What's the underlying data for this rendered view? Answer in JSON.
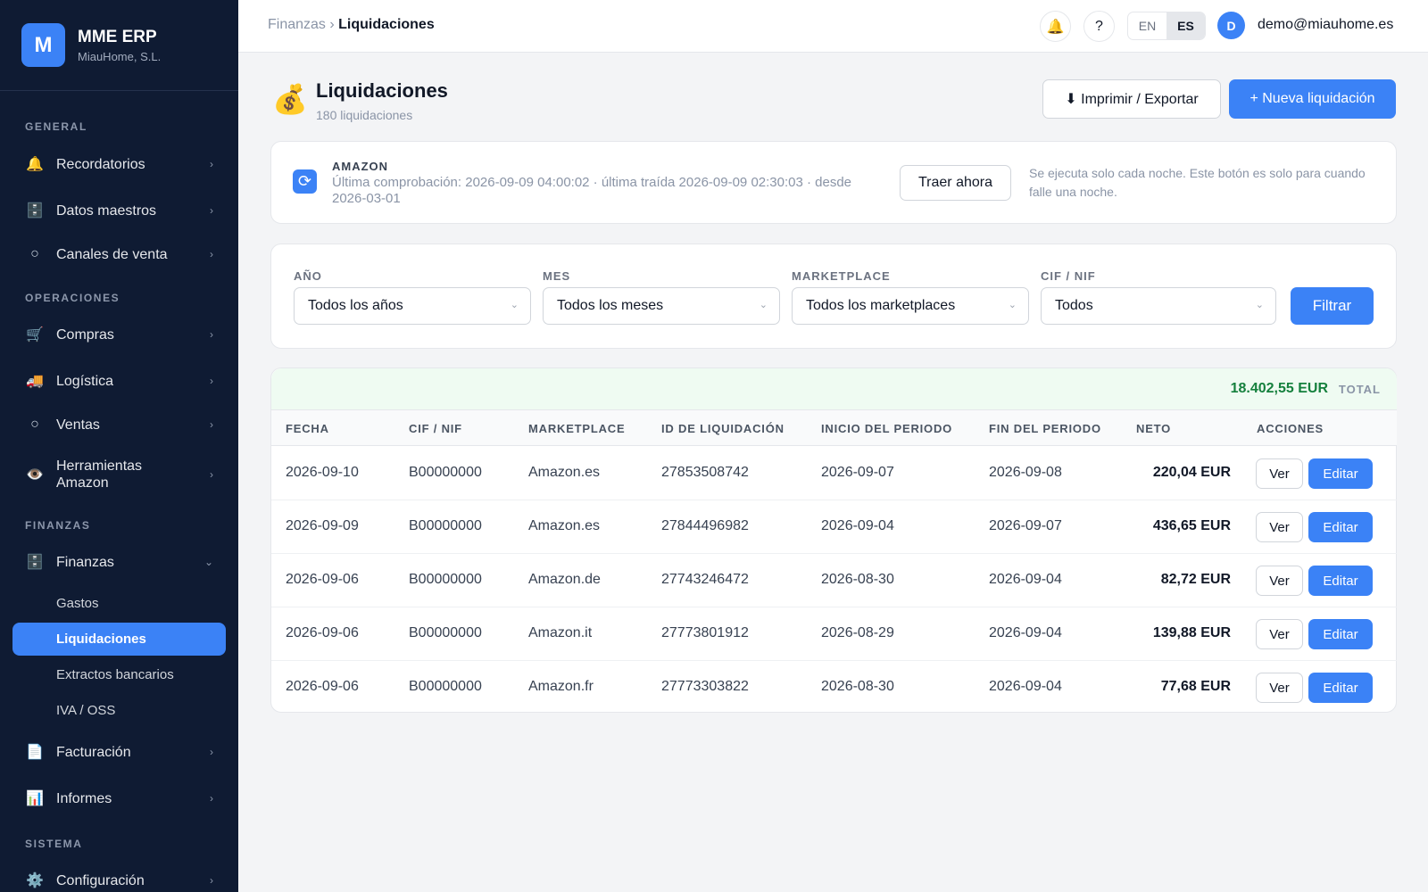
{
  "app": {
    "logo_letter": "M",
    "name": "MME ERP",
    "company": "MiauHome, S.L."
  },
  "sidebar": {
    "sections": {
      "general": "GENERAL",
      "operaciones": "OPERACIONES",
      "finanzas": "FINANZAS",
      "sistema": "SISTEMA"
    },
    "items": {
      "recordatorios": {
        "label": "Recordatorios",
        "icon": "bell-icon"
      },
      "datos_maestros": {
        "label": "Datos maestros",
        "icon": "cabinet-icon"
      },
      "canales_venta": {
        "label": "Canales de venta",
        "icon": "circle-icon"
      },
      "compras": {
        "label": "Compras",
        "icon": "cart-icon"
      },
      "logistica": {
        "label": "Logística",
        "icon": "truck-icon"
      },
      "ventas": {
        "label": "Ventas",
        "icon": "circle-icon"
      },
      "herramientas_amazon": {
        "label": "Herramientas Amazon",
        "icon": "eye-icon"
      },
      "finanzas": {
        "label": "Finanzas",
        "icon": "cabinet-icon"
      },
      "facturacion": {
        "label": "Facturación",
        "icon": "document-icon"
      },
      "informes": {
        "label": "Informes",
        "icon": "bar-chart-icon"
      },
      "configuracion": {
        "label": "Configuración",
        "icon": "gear-icon"
      }
    },
    "finanzas_sub": {
      "gastos": "Gastos",
      "liquidaciones": "Liquidaciones",
      "extractos": "Extractos bancarios",
      "iva": "IVA / OSS"
    }
  },
  "topbar": {
    "breadcrumb_parent": "Finanzas",
    "breadcrumb_sep": "›",
    "breadcrumb_current": "Liquidaciones",
    "help": "?",
    "lang_en": "EN",
    "lang_es": "ES",
    "avatar_letter": "D",
    "user_email": "demo@miauhome.es"
  },
  "page": {
    "icon": "money-bag-icon",
    "title": "Liquidaciones",
    "subtitle": "180 liquidaciones",
    "export_label": "⬇ Imprimir / Exportar",
    "new_label": "+ Nueva liquidación"
  },
  "sync": {
    "title": "AMAZON",
    "meta": "Última comprobación: 2026-09-09 04:00:02 · última traída 2026-09-09 02:30:03 · desde 2026-03-01",
    "fetch_label": "Traer ahora",
    "note": "Se ejecuta solo cada noche. Este botón es solo para cuando falle una noche."
  },
  "filters": {
    "year": {
      "label": "AÑO",
      "value": "Todos los años"
    },
    "month": {
      "label": "MES",
      "value": "Todos los meses"
    },
    "marketplace": {
      "label": "MARKETPLACE",
      "value": "Todos los marketplaces"
    },
    "cif": {
      "label": "CIF / NIF",
      "value": "Todos"
    },
    "submit_label": "Filtrar"
  },
  "table": {
    "total_value": "18.402,55 EUR",
    "total_label": "TOTAL",
    "columns": [
      "FECHA",
      "CIF / NIF",
      "MARKETPLACE",
      "ID DE LIQUIDACIÓN",
      "INICIO DEL PERIODO",
      "FIN DEL PERIODO",
      "NETO",
      "ACCIONES"
    ],
    "view_label": "Ver",
    "edit_label": "Editar",
    "rows": [
      {
        "fecha": "2026-09-10",
        "cif": "B00000000",
        "marketplace": "Amazon.es",
        "id": "27853508742",
        "inicio": "2026-09-07",
        "fin": "2026-09-08",
        "neto": "220,04 EUR"
      },
      {
        "fecha": "2026-09-09",
        "cif": "B00000000",
        "marketplace": "Amazon.es",
        "id": "27844496982",
        "inicio": "2026-09-04",
        "fin": "2026-09-07",
        "neto": "436,65 EUR"
      },
      {
        "fecha": "2026-09-06",
        "cif": "B00000000",
        "marketplace": "Amazon.de",
        "id": "27743246472",
        "inicio": "2026-08-30",
        "fin": "2026-09-04",
        "neto": "82,72 EUR"
      },
      {
        "fecha": "2026-09-06",
        "cif": "B00000000",
        "marketplace": "Amazon.it",
        "id": "27773801912",
        "inicio": "2026-08-29",
        "fin": "2026-09-04",
        "neto": "139,88 EUR"
      },
      {
        "fecha": "2026-09-06",
        "cif": "B00000000",
        "marketplace": "Amazon.fr",
        "id": "27773303822",
        "inicio": "2026-08-30",
        "fin": "2026-09-04",
        "neto": "77,68 EUR"
      }
    ]
  },
  "colors": {
    "accent": "#3b82f6",
    "sidebar_bg": "#0f1b33",
    "total_green": "#15803d"
  }
}
